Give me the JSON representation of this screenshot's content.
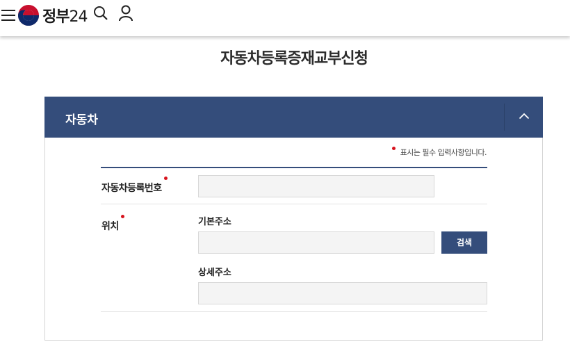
{
  "header": {
    "logo_text": "정부",
    "logo_num": "24",
    "menu_icon": "hamburger-menu-icon",
    "search_icon": "search-icon",
    "user_icon": "user-icon"
  },
  "page": {
    "title": "자동차등록증재교부신청"
  },
  "panel": {
    "title": "자동차",
    "collapse_icon": "chevron-up-icon",
    "required_note": "표시는 필수 입력사항입니다.",
    "fields": {
      "registration_number_label": "자동차등록번호",
      "registration_number_value": "",
      "location_label": "위치",
      "basic_address_label": "기본주소",
      "basic_address_value": "",
      "search_button": "검색",
      "detail_address_label": "상세주소",
      "detail_address_value": ""
    }
  },
  "colors": {
    "primary": "#344d7b",
    "required": "#d7131d",
    "input_bg": "#f4f4f4"
  }
}
